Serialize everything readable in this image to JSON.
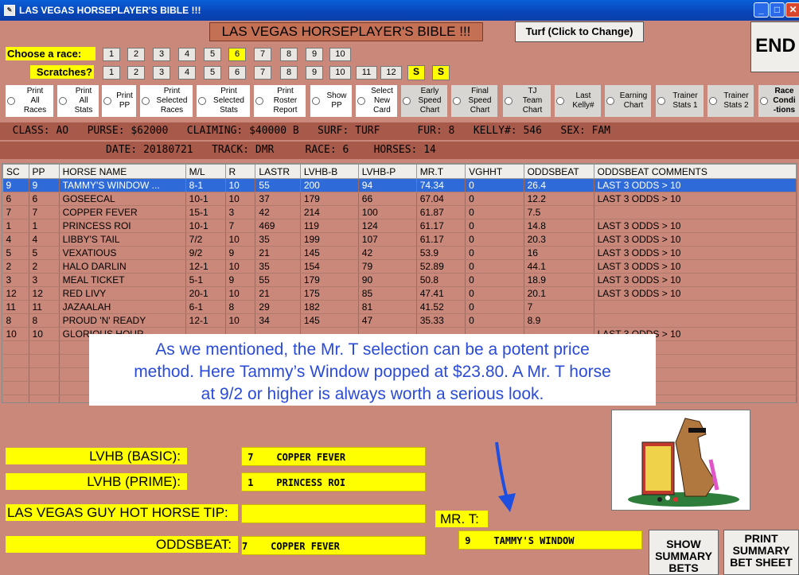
{
  "window": {
    "title": "LAS VEGAS HORSEPLAYER'S BIBLE !!!",
    "main_title": "LAS VEGAS HORSEPLAYER'S BIBLE !!!"
  },
  "buttons": {
    "turf": "Turf (Click to Change)",
    "end": "END",
    "show_summary": "SHOW SUMMARY BETS",
    "print_summary": "PRINT SUMMARY BET SHEET"
  },
  "race_select": {
    "label": "Choose  a race:",
    "numbers": [
      "1",
      "2",
      "3",
      "4",
      "5",
      "6",
      "7",
      "8",
      "9",
      "10"
    ],
    "selected": "6"
  },
  "scratches": {
    "label": "Scratches?",
    "numbers": [
      "1",
      "2",
      "3",
      "4",
      "5",
      "6",
      "7",
      "8",
      "9",
      "10",
      "11",
      "12"
    ],
    "s1": "S",
    "s2": "S"
  },
  "options": [
    {
      "l1": "Print",
      "l2": "All",
      "l3": "Races"
    },
    {
      "l1": "Print",
      "l2": "All",
      "l3": "Stats"
    },
    {
      "l1": "Print",
      "l2": "PP",
      "l3": ""
    },
    {
      "l1": "Print",
      "l2": "Selected",
      "l3": "Races"
    },
    {
      "l1": "Print",
      "l2": "Selected",
      "l3": "Stats"
    },
    {
      "l1": "Print",
      "l2": "Roster",
      "l3": "Report"
    },
    {
      "l1": "Show",
      "l2": "PP",
      "l3": ""
    },
    {
      "l1": "Select",
      "l2": "New",
      "l3": "Card"
    },
    {
      "l1": "Early",
      "l2": "Speed",
      "l3": "Chart"
    },
    {
      "l1": "Final",
      "l2": "Speed",
      "l3": "Chart"
    },
    {
      "l1": "TJ",
      "l2": "Team",
      "l3": "Chart"
    },
    {
      "l1": "Last",
      "l2": "Kelly#",
      "l3": ""
    },
    {
      "l1": "Earning",
      "l2": "Chart",
      "l3": ""
    },
    {
      "l1": "Trainer",
      "l2": "Stats 1",
      "l3": ""
    },
    {
      "l1": "Trainer",
      "l2": "Stats 2",
      "l3": ""
    },
    {
      "l1": "Race",
      "l2": "Condi",
      "l3": "-tions"
    }
  ],
  "info": {
    "line1": "  CLASS: AO   PURSE: $62000   CLAIMING: $40000 B   SURF: TURF      FUR: 8   KELLY#: 546   SEX: FAM",
    "line2": "                 DATE: 20180721   TRACK: DMR     RACE: 6    HORSES: 14"
  },
  "table": {
    "headers": [
      "SC",
      "PP",
      "HORSE NAME",
      "M/L",
      "R",
      "LASTR",
      "LVHB-B",
      "LVHB-P",
      "MR.T",
      "VGHHT",
      "ODDSBEAT",
      "ODDSBEAT COMMENTS"
    ],
    "rows": [
      [
        "9",
        "9",
        "TAMMY'S WINDOW ...",
        "8-1",
        "10",
        "55",
        "200",
        "94",
        "74.34",
        "0",
        "26.4",
        "LAST 3 ODDS > 10"
      ],
      [
        "6",
        "6",
        "GOSEECAL",
        "10-1",
        "10",
        "37",
        "179",
        "66",
        "67.04",
        "0",
        "12.2",
        "LAST 3 ODDS > 10"
      ],
      [
        "7",
        "7",
        "COPPER FEVER",
        "15-1",
        "3",
        "42",
        "214",
        "100",
        "61.87",
        "0",
        "7.5",
        ""
      ],
      [
        "1",
        "1",
        "PRINCESS ROI",
        "10-1",
        "7",
        "469",
        "119",
        "124",
        "61.17",
        "0",
        "14.8",
        "LAST 3 ODDS > 10"
      ],
      [
        "4",
        "4",
        "LIBBY'S TAIL",
        "7/2",
        "10",
        "35",
        "199",
        "107",
        "61.17",
        "0",
        "20.3",
        "LAST 3 ODDS > 10"
      ],
      [
        "5",
        "5",
        "VEXATIOUS",
        "9/2",
        "9",
        "21",
        "145",
        "42",
        "53.9",
        "0",
        "16",
        "LAST 3 ODDS > 10"
      ],
      [
        "2",
        "2",
        "HALO DARLIN",
        "12-1",
        "10",
        "35",
        "154",
        "79",
        "52.89",
        "0",
        "44.1",
        "LAST 3 ODDS > 10"
      ],
      [
        "3",
        "3",
        "MEAL TICKET",
        "5-1",
        "9",
        "55",
        "179",
        "90",
        "50.8",
        "0",
        "18.9",
        "LAST 3 ODDS > 10"
      ],
      [
        "12",
        "12",
        "RED LIVY",
        "20-1",
        "10",
        "21",
        "175",
        "85",
        "47.41",
        "0",
        "20.1",
        "LAST 3 ODDS > 10"
      ],
      [
        "11",
        "11",
        "JAZAALAH",
        "6-1",
        "8",
        "29",
        "182",
        "81",
        "41.52",
        "0",
        "7",
        ""
      ],
      [
        "8",
        "8",
        "PROUD 'N' READY",
        "12-1",
        "10",
        "34",
        "145",
        "47",
        "35.33",
        "0",
        "8.9",
        ""
      ],
      [
        "10",
        "10",
        "GLORIOUS HOUR",
        "",
        "",
        "",
        "",
        "",
        "",
        "",
        "",
        "LAST 3 ODDS > 10"
      ]
    ]
  },
  "overlay": {
    "line1": "As we mentioned, the Mr. T selection can be a potent price",
    "line2": "method.  Here Tammy’s Window popped at $23.80.  A Mr. T horse",
    "line3": "at 9/2 or higher is always worth a serious look."
  },
  "fields": {
    "basic_label": "LVHB (BASIC):",
    "basic_value": " 7    COPPER FEVER",
    "prime_label": "LVHB (PRIME):",
    "prime_value": " 1    PRINCESS ROI",
    "hot_label": "LAS VEGAS GUY HOT HORSE TIP:",
    "hot_value": "",
    "oddsbeat_label": "ODDSBEAT:",
    "oddsbeat_value": "7    COPPER FEVER",
    "mrt_label": "MR. T:",
    "mrt_value": " 9    TAMMY'S WINDOW"
  },
  "colors": {
    "background": "#c9887a",
    "highlight": "#2f6bd8",
    "yellow": "#ffff00",
    "arrow": "#1f4fe0"
  }
}
